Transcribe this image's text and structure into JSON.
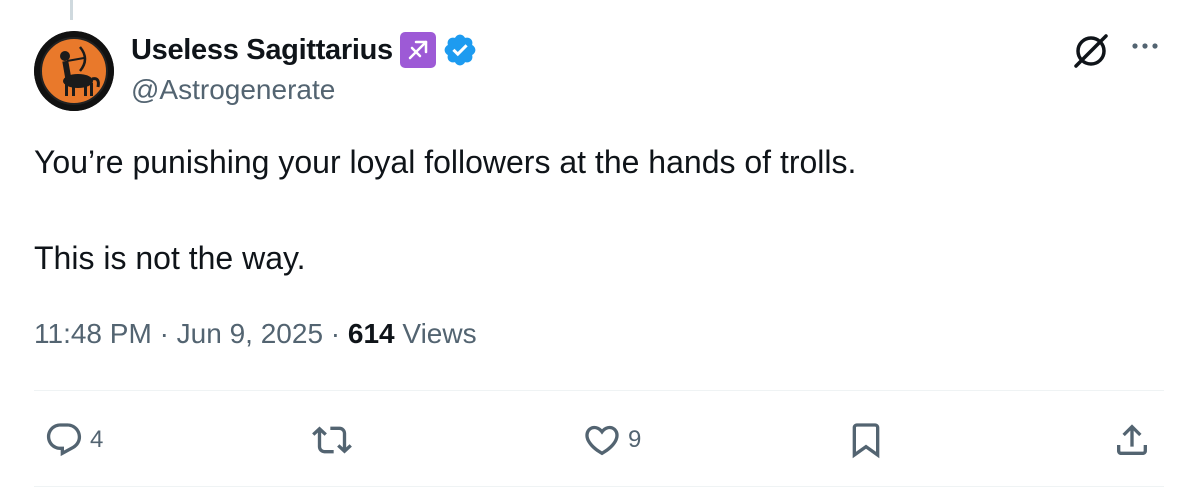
{
  "tweet": {
    "author": {
      "display_name": "Useless Sagittarius",
      "handle": "@Astrogenerate",
      "zodiac_emoji": "sagittarius-icon",
      "verified_icon": "verified-badge-icon",
      "avatar": "centaur-archer-avatar"
    },
    "text_paragraphs": [
      "You’re punishing your loyal followers at the hands of trolls.",
      "This is not the way."
    ],
    "time": "11:48 PM",
    "date": "Jun 9, 2025",
    "separator": "·",
    "views_count": "614",
    "views_label": "Views",
    "actions": {
      "reply_count": "4",
      "repost_count": "",
      "like_count": "9",
      "bookmark_count": "",
      "share_count": ""
    },
    "icons": {
      "grok": "grok-icon",
      "more": "more-options-icon"
    }
  },
  "colors": {
    "text": "#0f1419",
    "secondary": "#536471",
    "verified_blue": "#1d9bf0",
    "zodiac_purple": "#9d5ad6",
    "divider": "#eff3f4"
  }
}
